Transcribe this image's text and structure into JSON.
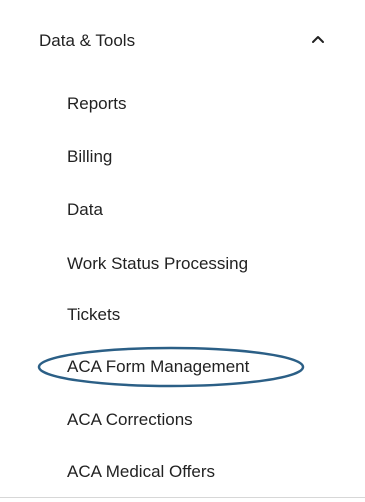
{
  "section": {
    "title": "Data & Tools",
    "expanded_icon": "chevron-up-icon"
  },
  "menu": {
    "items": [
      {
        "label": "Reports"
      },
      {
        "label": "Billing"
      },
      {
        "label": "Data"
      },
      {
        "label": "Work Status Processing"
      },
      {
        "label": "Tickets"
      },
      {
        "label": "ACA Form Management"
      },
      {
        "label": "ACA Corrections"
      },
      {
        "label": "ACA Medical Offers"
      }
    ]
  },
  "colors": {
    "text": "#222222",
    "highlight_ellipse": "#2b5f86",
    "divider": "#d7d7d7"
  }
}
